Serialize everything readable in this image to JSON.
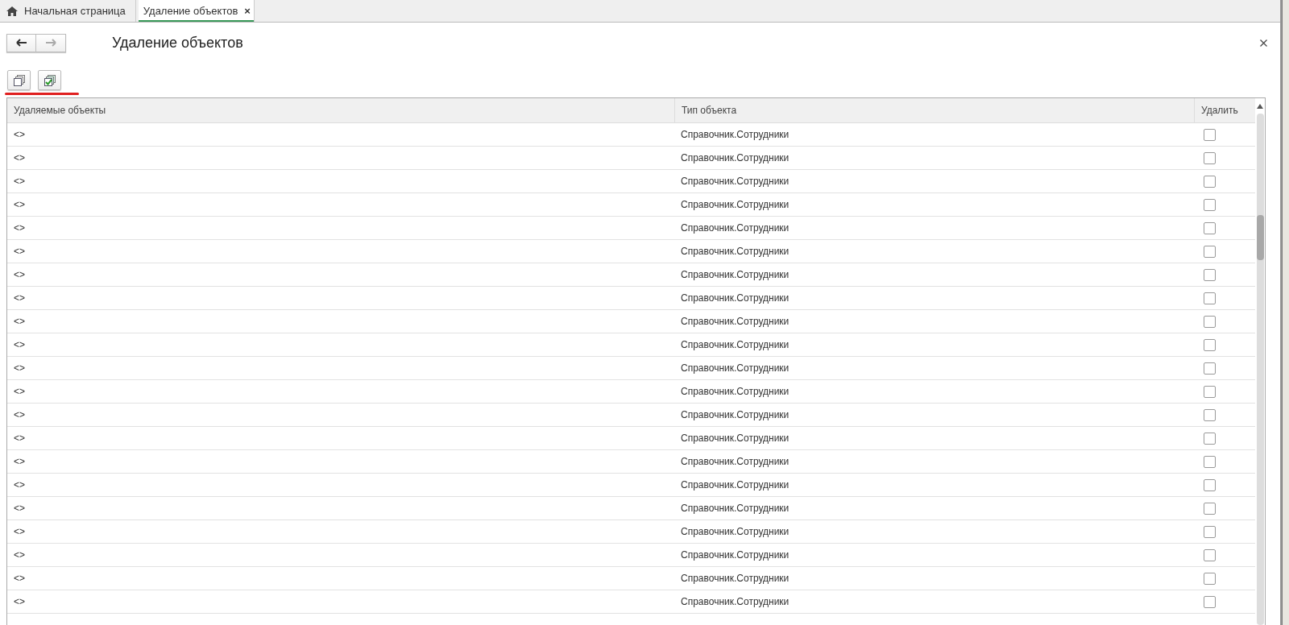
{
  "tabs": [
    {
      "label": "Начальная страница",
      "kind": "home",
      "selected": false
    },
    {
      "label": "Удаление объектов",
      "kind": "closable",
      "selected": true
    }
  ],
  "tab_close": "×",
  "form": {
    "title": "Удаление объектов",
    "back_enabled": true,
    "forward_enabled": false
  },
  "table": {
    "columns": [
      "Удаляемые объекты",
      "Тип объекта",
      "Удалить"
    ],
    "rows": [
      {
        "object": "<>",
        "type": "Справочник.Сотрудники",
        "checked": false
      },
      {
        "object": "<>",
        "type": "Справочник.Сотрудники",
        "checked": false
      },
      {
        "object": "<>",
        "type": "Справочник.Сотрудники",
        "checked": false
      },
      {
        "object": "<>",
        "type": "Справочник.Сотрудники",
        "checked": false
      },
      {
        "object": "<>",
        "type": "Справочник.Сотрудники",
        "checked": false
      },
      {
        "object": "<>",
        "type": "Справочник.Сотрудники",
        "checked": false
      },
      {
        "object": "<>",
        "type": "Справочник.Сотрудники",
        "checked": false
      },
      {
        "object": "<>",
        "type": "Справочник.Сотрудники",
        "checked": false
      },
      {
        "object": "<>",
        "type": "Справочник.Сотрудники",
        "checked": false
      },
      {
        "object": "<>",
        "type": "Справочник.Сотрудники",
        "checked": false
      },
      {
        "object": "<>",
        "type": "Справочник.Сотрудники",
        "checked": false
      },
      {
        "object": "<>",
        "type": "Справочник.Сотрудники",
        "checked": false
      },
      {
        "object": "<>",
        "type": "Справочник.Сотрудники",
        "checked": false
      },
      {
        "object": "<>",
        "type": "Справочник.Сотрудники",
        "checked": false
      },
      {
        "object": "<>",
        "type": "Справочник.Сотрудники",
        "checked": false
      },
      {
        "object": "<>",
        "type": "Справочник.Сотрудники",
        "checked": false
      },
      {
        "object": "<>",
        "type": "Справочник.Сотрудники",
        "checked": false
      },
      {
        "object": "<>",
        "type": "Справочник.Сотрудники",
        "checked": false
      },
      {
        "object": "<>",
        "type": "Справочник.Сотрудники",
        "checked": false
      },
      {
        "object": "<>",
        "type": "Справочник.Сотрудники",
        "checked": false
      },
      {
        "object": "<>",
        "type": "Справочник.Сотрудники",
        "checked": false
      }
    ]
  }
}
